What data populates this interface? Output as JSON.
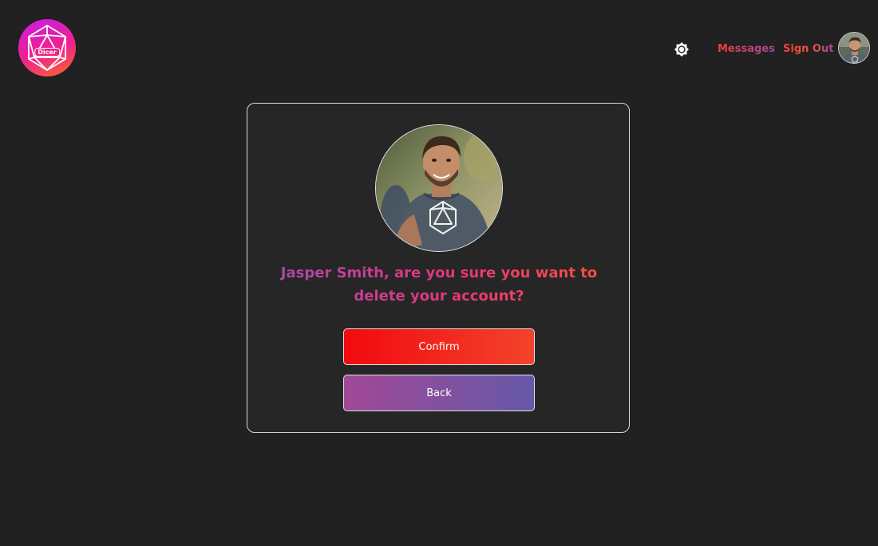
{
  "header": {
    "logo_text": "Dicer",
    "nav": {
      "messages_label": "Messages",
      "signout_label": "Sign Out"
    },
    "icons": {
      "theme": "sun-icon",
      "avatar": "user-avatar"
    }
  },
  "dialog": {
    "question": "Jasper Smith, are you sure you want to delete your account?",
    "confirm_label": "Confirm",
    "back_label": "Back"
  },
  "colors": {
    "background": "#212121",
    "accent_red": "#f20a0f",
    "accent_orange": "#f2432b",
    "accent_purple": "#6559a8",
    "accent_magenta": "#a14896"
  }
}
